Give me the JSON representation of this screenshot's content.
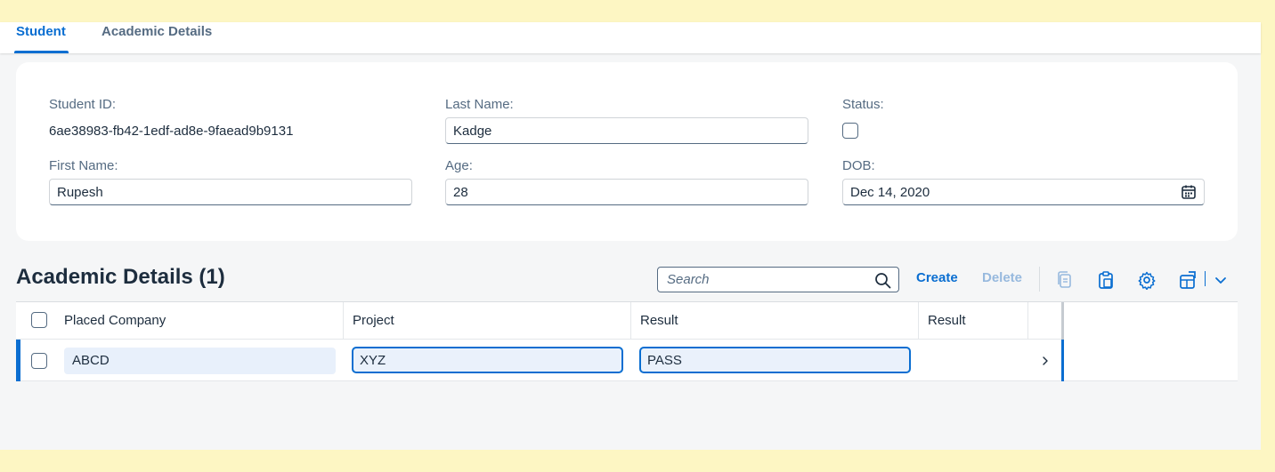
{
  "tabs": [
    {
      "label": "Student",
      "active": true
    },
    {
      "label": "Academic Details",
      "active": false
    }
  ],
  "student": {
    "id_label": "Student ID:",
    "id_value": "6ae38983-fb42-1edf-ad8e-9faead9b9131",
    "first_name_label": "First Name:",
    "first_name_value": "Rupesh",
    "last_name_label": "Last Name:",
    "last_name_value": "Kadge",
    "age_label": "Age:",
    "age_value": "28",
    "status_label": "Status:",
    "status_checked": false,
    "dob_label": "DOB:",
    "dob_value": "Dec 14, 2020"
  },
  "academic": {
    "title": "Academic Details (1)",
    "search_placeholder": "Search",
    "create_label": "Create",
    "delete_label": "Delete",
    "columns": [
      "Placed Company",
      "Project",
      "Result",
      "Result"
    ],
    "rows": [
      {
        "placed_company": "ABCD",
        "project": "XYZ",
        "result": "PASS",
        "result2": ""
      }
    ]
  },
  "icons": [
    "calendar-icon",
    "search-icon",
    "copy-icon",
    "paste-icon",
    "settings-icon",
    "export-icon",
    "chevron-down-icon",
    "chevron-right-icon"
  ],
  "colors": {
    "accent": "#0a6ed1",
    "disabled": "#97b9de",
    "text": "#1d2d3e",
    "label": "#556b82",
    "page_background": "#fdf6c3"
  }
}
